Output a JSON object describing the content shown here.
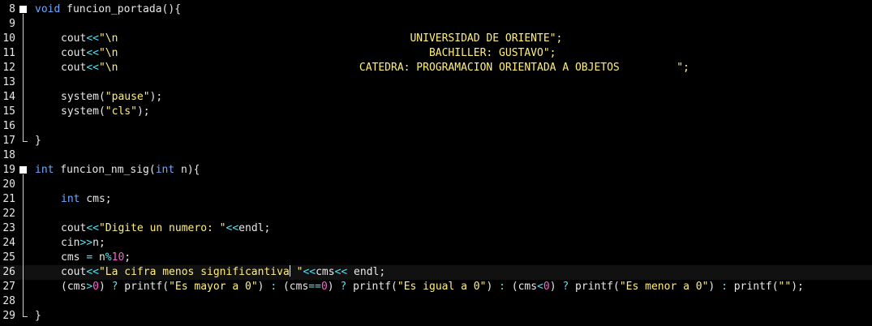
{
  "editor": {
    "lines": [
      {
        "n": "8",
        "parts": [
          [
            "kw",
            "void"
          ],
          [
            "fn",
            " funcion_portada(){"
          ]
        ]
      },
      {
        "n": "9",
        "parts": []
      },
      {
        "n": "10",
        "parts": [
          [
            "txt",
            "cout"
          ],
          [
            "op",
            "<<"
          ],
          [
            "str",
            "\"\\n                                              UNIVERSIDAD DE ORIENTE\";"
          ]
        ]
      },
      {
        "n": "11",
        "parts": [
          [
            "txt",
            "cout"
          ],
          [
            "op",
            "<<"
          ],
          [
            "str",
            "\"\\n                                                 BACHILLER: GUSTAVO\";"
          ]
        ]
      },
      {
        "n": "12",
        "parts": [
          [
            "txt",
            "cout"
          ],
          [
            "op",
            "<<"
          ],
          [
            "str",
            "\"\\n                                      CATEDRA: PROGRAMACION ORIENTADA A OBJETOS         \";"
          ]
        ]
      },
      {
        "n": "13",
        "parts": []
      },
      {
        "n": "14",
        "parts": [
          [
            "txt",
            "system("
          ],
          [
            "str",
            "\"pause\""
          ],
          [
            "txt",
            ");"
          ]
        ]
      },
      {
        "n": "15",
        "parts": [
          [
            "txt",
            "system("
          ],
          [
            "str",
            "\"cls\""
          ],
          [
            "txt",
            ");"
          ]
        ]
      },
      {
        "n": "16",
        "parts": []
      },
      {
        "n": "17",
        "parts": [
          [
            "txt",
            "}"
          ]
        ]
      },
      {
        "n": "18",
        "parts": []
      },
      {
        "n": "19",
        "parts": [
          [
            "kw",
            "int"
          ],
          [
            "fn",
            " funcion_nm_sig("
          ],
          [
            "kw",
            "int"
          ],
          [
            "fn",
            " n){"
          ]
        ]
      },
      {
        "n": "20",
        "parts": []
      },
      {
        "n": "21",
        "parts": [
          [
            "kw",
            "int"
          ],
          [
            "txt",
            " cms;"
          ]
        ]
      },
      {
        "n": "22",
        "parts": []
      },
      {
        "n": "23",
        "parts": [
          [
            "txt",
            "cout"
          ],
          [
            "op",
            "<<"
          ],
          [
            "str",
            "\"Digite un numero: \""
          ],
          [
            "op",
            "<<"
          ],
          [
            "txt",
            "endl;"
          ]
        ]
      },
      {
        "n": "24",
        "parts": [
          [
            "txt",
            "cin"
          ],
          [
            "op",
            ">>"
          ],
          [
            "txt",
            "n;"
          ]
        ]
      },
      {
        "n": "25",
        "parts": [
          [
            "txt",
            "cms "
          ],
          [
            "op",
            "="
          ],
          [
            "txt",
            " n"
          ],
          [
            "op",
            "%"
          ],
          [
            "num",
            "10"
          ],
          [
            "txt",
            ";"
          ]
        ]
      },
      {
        "n": "26",
        "parts": [
          [
            "txt",
            "cout"
          ],
          [
            "op",
            "<<"
          ],
          [
            "str",
            "\"La cifra menos significantiva"
          ],
          [
            "caret",
            ""
          ],
          [
            "str",
            " \""
          ],
          [
            "op",
            "<<"
          ],
          [
            "txt",
            "cms"
          ],
          [
            "op",
            "<<"
          ],
          [
            "txt",
            " endl;"
          ]
        ]
      },
      {
        "n": "27",
        "parts": [
          [
            "txt",
            "(cms"
          ],
          [
            "op",
            ">"
          ],
          [
            "num",
            "0"
          ],
          [
            "txt",
            ") "
          ],
          [
            "op",
            "?"
          ],
          [
            "txt",
            " printf("
          ],
          [
            "str",
            "\"Es mayor a 0\""
          ],
          [
            "txt",
            ") "
          ],
          [
            "op",
            ":"
          ],
          [
            "txt",
            " (cms"
          ],
          [
            "op",
            "=="
          ],
          [
            "num",
            "0"
          ],
          [
            "txt",
            ") "
          ],
          [
            "op",
            "?"
          ],
          [
            "txt",
            " printf("
          ],
          [
            "str",
            "\"Es igual a 0\""
          ],
          [
            "txt",
            ") "
          ],
          [
            "op",
            ":"
          ],
          [
            "txt",
            " (cms"
          ],
          [
            "op",
            "<"
          ],
          [
            "num",
            "0"
          ],
          [
            "txt",
            ") "
          ],
          [
            "op",
            "?"
          ],
          [
            "txt",
            " printf("
          ],
          [
            "str",
            "\"Es menor a 0\""
          ],
          [
            "txt",
            ") "
          ],
          [
            "op",
            ":"
          ],
          [
            "txt",
            " printf("
          ],
          [
            "str",
            "\"\""
          ],
          [
            "txt",
            ");"
          ]
        ]
      },
      {
        "n": "28",
        "parts": []
      },
      {
        "n": "29",
        "parts": [
          [
            "txt",
            "}"
          ]
        ]
      }
    ]
  },
  "colors": {
    "background": "#000000",
    "keyword": "#6fa8ff",
    "string": "#ffef7a",
    "operator": "#4fe4f0",
    "number": "#ff5fd2",
    "text": "#e8e8e8",
    "current_line": "#111111"
  },
  "icons": {
    "fold_marker": "fold-collapse-icon",
    "fold_end": "fold-end-icon"
  }
}
